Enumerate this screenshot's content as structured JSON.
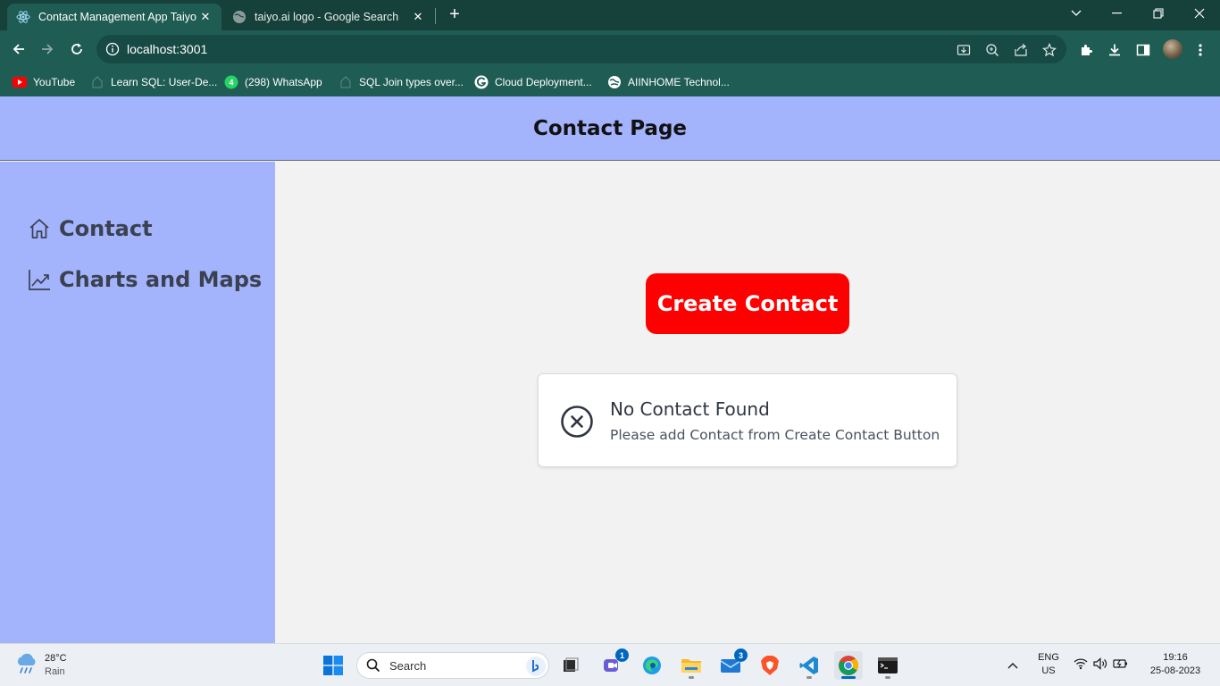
{
  "browser": {
    "tabs": [
      {
        "title": "Contact Management App Taiyo",
        "active": true
      },
      {
        "title": "taiyo.ai logo - Google Search",
        "active": false
      }
    ],
    "url": "localhost:3001",
    "bookmarks": [
      {
        "label": "YouTube",
        "icon": "youtube-icon"
      },
      {
        "label": "Learn SQL: User-De...",
        "icon": "globe-icon"
      },
      {
        "label": "(298) WhatsApp",
        "icon": "whatsapp-icon"
      },
      {
        "label": "SQL Join types over...",
        "icon": "globe-icon"
      },
      {
        "label": "Cloud Deployment...",
        "icon": "google-icon"
      },
      {
        "label": "AIINHOME Technol...",
        "icon": "globe-icon"
      }
    ]
  },
  "header": {
    "title": "Contact Page"
  },
  "sidebar": {
    "items": [
      {
        "label": "Contact",
        "icon": "home-icon"
      },
      {
        "label": "Charts and Maps",
        "icon": "chart-line-icon"
      }
    ]
  },
  "main": {
    "create_button": "Create Contact",
    "empty_state": {
      "title": "No Contact Found",
      "message": "Please add Contact from Create Contact Button"
    }
  },
  "taskbar": {
    "weather": {
      "temp": "28°C",
      "condition": "Rain"
    },
    "search_placeholder": "Search",
    "badges": {
      "teams": "1",
      "mail": "3"
    },
    "language": {
      "line1": "ENG",
      "line2": "US"
    },
    "clock": {
      "time": "19:16",
      "date": "25-08-2023"
    }
  },
  "colors": {
    "header_bg": "#a3b3fc",
    "sidebar_bg": "#a3b3fc",
    "main_bg": "#f2f2f2",
    "create_button_bg": "#ff0000",
    "browser_chrome": "#1f5c54"
  }
}
